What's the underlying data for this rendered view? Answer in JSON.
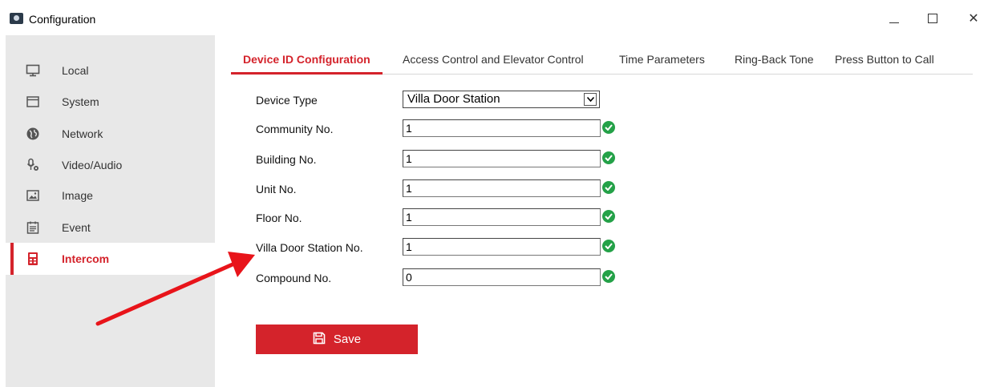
{
  "window": {
    "title": "Configuration",
    "minimize_glyph": "—",
    "maximize_glyph": "☐",
    "close_glyph": "✕"
  },
  "sidebar": {
    "items": [
      {
        "label": "Local",
        "icon": "monitor-icon"
      },
      {
        "label": "System",
        "icon": "window-icon"
      },
      {
        "label": "Network",
        "icon": "globe-icon"
      },
      {
        "label": "Video/Audio",
        "icon": "microphone-icon"
      },
      {
        "label": "Image",
        "icon": "image-icon"
      },
      {
        "label": "Event",
        "icon": "calendar-icon"
      },
      {
        "label": "Intercom",
        "icon": "intercom-icon",
        "active": true
      }
    ]
  },
  "tabs": [
    {
      "label": "Device ID Configuration",
      "active": true
    },
    {
      "label": "Access Control and Elevator Control"
    },
    {
      "label": "Time Parameters"
    },
    {
      "label": "Ring-Back Tone"
    },
    {
      "label": "Press Button to Call"
    }
  ],
  "form": {
    "device_type": {
      "label": "Device Type",
      "value": "Villa Door Station"
    },
    "fields": [
      {
        "label": "Community No.",
        "value": "1"
      },
      {
        "label": "Building No.",
        "value": "1"
      },
      {
        "label": "Unit No.",
        "value": "1"
      },
      {
        "label": "Floor No.",
        "value": "1"
      },
      {
        "label": "Villa Door Station No.",
        "value": "1"
      },
      {
        "label": "Compound No.",
        "value": "0"
      }
    ]
  },
  "actions": {
    "save_label": "Save"
  },
  "colors": {
    "accent": "#d4232b",
    "sidebar_bg": "#e8e8e8",
    "valid_green": "#24a148"
  }
}
